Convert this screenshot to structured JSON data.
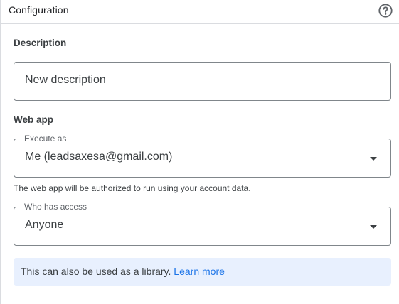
{
  "header": {
    "title": "Configuration",
    "help_icon": "help-circle-icon"
  },
  "description": {
    "section_label": "Description",
    "placeholder": "New description",
    "value": ""
  },
  "web_app": {
    "section_label": "Web app",
    "execute_as": {
      "label": "Execute as",
      "value": "Me (leadsaxesa@gmail.com)"
    },
    "execute_hint": "The web app will be authorized to run using your account data.",
    "who_has_access": {
      "label": "Who has access",
      "value": "Anyone"
    }
  },
  "info": {
    "text": "This can also be used as a library.",
    "link_label": "Learn more"
  },
  "colors": {
    "accent": "#1a73e8",
    "info_background": "#e8f0fe",
    "border": "#80868b"
  }
}
